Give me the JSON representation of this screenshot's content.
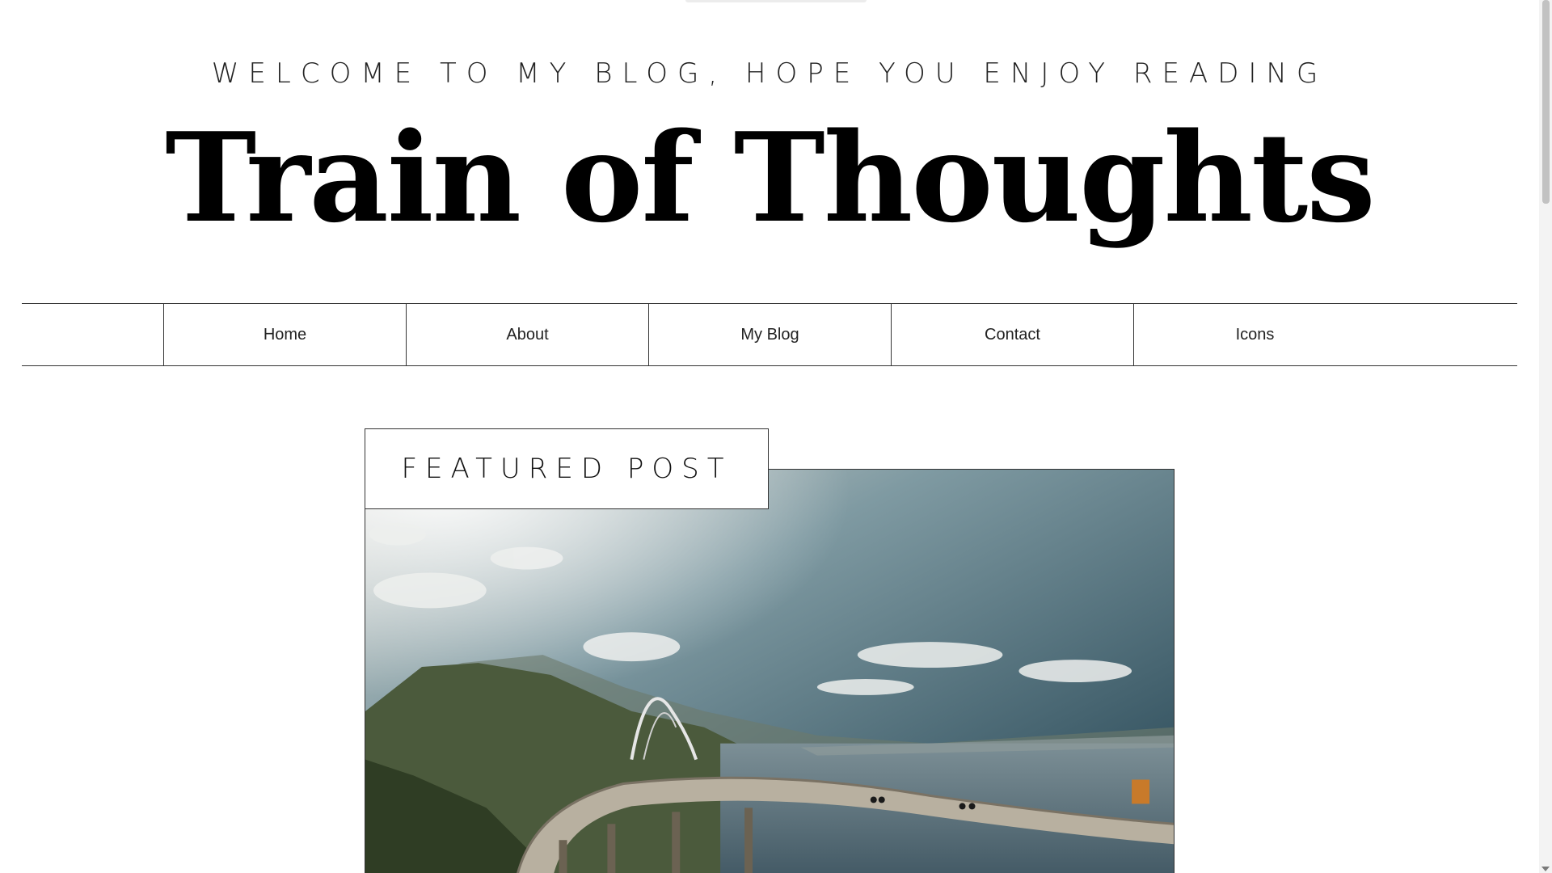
{
  "header": {
    "tagline": "WELCOME TO MY BLOG, HOPE YOU ENJOY READING",
    "title": "Train of Thoughts"
  },
  "nav": {
    "items": [
      {
        "label": "Home"
      },
      {
        "label": "About"
      },
      {
        "label": "My Blog"
      },
      {
        "label": "Contact"
      },
      {
        "label": "Icons"
      }
    ]
  },
  "featured": {
    "label": "FEATURED POST"
  }
}
